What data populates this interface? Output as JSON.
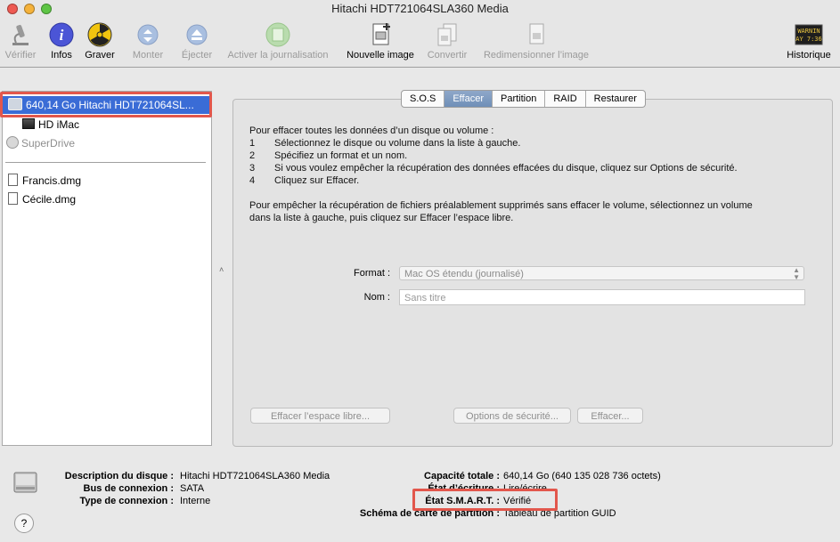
{
  "window": {
    "title": "Hitachi HDT721064SLA360 Media",
    "colors": {
      "close": "#ee5a52",
      "minimize": "#f5b23a",
      "zoom": "#5ec545",
      "selection": "#3a6cd6",
      "highlight": "#e2574c"
    }
  },
  "toolbar": {
    "items": [
      {
        "label": "Vérifier",
        "icon": "microscope-icon",
        "enabled": false
      },
      {
        "label": "Infos",
        "icon": "info-icon",
        "enabled": true
      },
      {
        "label": "Graver",
        "icon": "burn-icon",
        "enabled": true
      },
      {
        "label": "Monter",
        "icon": "mount-icon",
        "enabled": false
      },
      {
        "label": "Éjecter",
        "icon": "eject-icon",
        "enabled": false
      },
      {
        "label": "Activer la journalisation",
        "icon": "journal-icon",
        "enabled": false
      },
      {
        "label": "Nouvelle image",
        "icon": "new-image-icon",
        "enabled": true
      },
      {
        "label": "Convertir",
        "icon": "convert-icon",
        "enabled": false
      },
      {
        "label": "Redimensionner l’image",
        "icon": "resize-image-icon",
        "enabled": false
      },
      {
        "label": "Historique",
        "icon": "log-icon",
        "enabled": true
      }
    ],
    "log_icon_text_1": "WARNIN",
    "log_icon_text_2": "AY 7:36"
  },
  "sidebar": {
    "disk": "640,14 Go Hitachi HDT721064SL...",
    "volume": "HD iMac",
    "superdrive": "SuperDrive",
    "images": [
      "Francis.dmg",
      "Cécile.dmg"
    ]
  },
  "tabs": [
    {
      "label": "S.O.S",
      "active": false
    },
    {
      "label": "Effacer",
      "active": true
    },
    {
      "label": "Partition",
      "active": false
    },
    {
      "label": "RAID",
      "active": false
    },
    {
      "label": "Restaurer",
      "active": false
    }
  ],
  "erase": {
    "intro": "Pour effacer toutes les données d’un disque ou volume :",
    "steps": [
      {
        "num": "1",
        "text": "Sélectionnez le disque ou volume dans la liste à gauche."
      },
      {
        "num": "2",
        "text": "Spécifiez un format et un nom."
      },
      {
        "num": "3",
        "text": "Si vous voulez empêcher la récupération des données effacées du disque, cliquez sur Options de sécurité."
      },
      {
        "num": "4",
        "text": "Cliquez sur Effacer."
      }
    ],
    "free_space_line1": "Pour empêcher la récupération de fichiers préalablement supprimés sans effacer le volume, sélectionnez un volume",
    "free_space_line2": "dans la liste à gauche, puis cliquez sur Effacer l’espace libre.",
    "format_label": "Format :",
    "format_value": "Mac OS étendu (journalisé)",
    "name_label": "Nom :",
    "name_placeholder": "Sans titre",
    "btn_free_space": "Effacer l’espace libre...",
    "btn_security": "Options de sécurité...",
    "btn_erase": "Effacer..."
  },
  "info": {
    "description_label": "Description du disque :",
    "description_value": "Hitachi HDT721064SLA360 Media",
    "bus_label": "Bus de connexion :",
    "bus_value": "SATA",
    "type_label": "Type de connexion :",
    "type_value": "Interne",
    "capacity_label": "Capacité totale :",
    "capacity_value": "640,14 Go (640 135 028 736 octets)",
    "write_label": "État d’écriture :",
    "write_value": "Lire/écrire",
    "smart_label": "État S.M.A.R.T. :",
    "smart_value": "Vérifié",
    "scheme_label": "Schéma de carte de partition :",
    "scheme_value": "Tableau de partition GUID"
  },
  "help": "?"
}
